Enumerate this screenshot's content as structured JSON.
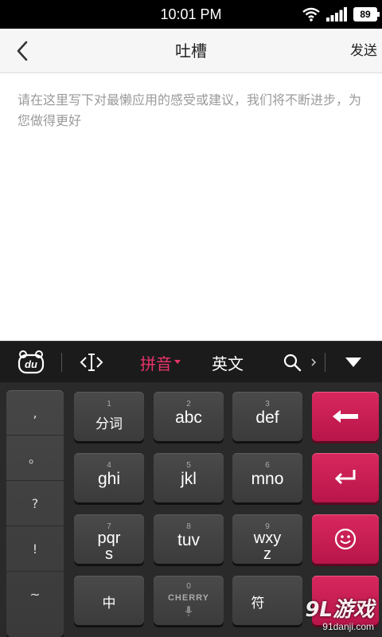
{
  "status_bar": {
    "time": "10:01 PM",
    "battery": "89",
    "icons": [
      "wifi-icon",
      "signal-icon",
      "battery-icon"
    ]
  },
  "header": {
    "title": "吐槽",
    "send_label": "发送",
    "back_icon": "chevron-left-icon"
  },
  "feedback": {
    "placeholder": "请在这里写下对最懒应用的感受或建议，我们将不断进步，为您做得更好",
    "value": ""
  },
  "keyboard_toolbar": {
    "logo": "du",
    "cursor_icon": "text-cursor-icon",
    "pinyin_label": "拼音",
    "english_label": "英文",
    "search_icon": "search-icon",
    "collapse_icon": "triangle-down-icon",
    "accent_color": "#e8336a"
  },
  "keyboard": {
    "punctuation": [
      ",",
      "。",
      "?",
      "!",
      "~"
    ],
    "keys": [
      {
        "num": "1",
        "label": "分词"
      },
      {
        "num": "2",
        "label": "abc"
      },
      {
        "num": "3",
        "label": "def"
      },
      {
        "num": "4",
        "label": "ghi"
      },
      {
        "num": "5",
        "label": "jkl"
      },
      {
        "num": "6",
        "label": "mno"
      },
      {
        "num": "7",
        "label": "pqr s"
      },
      {
        "num": "8",
        "label": "tuv"
      },
      {
        "num": "9",
        "label": "wxy z"
      },
      {
        "num": "",
        "label": "中"
      },
      {
        "num": "0",
        "label": "CHERRY"
      },
      {
        "num": "",
        "label": "符"
      }
    ],
    "side_keys": [
      "backspace-icon",
      "enter-icon",
      "smiley-icon",
      ""
    ],
    "key_color": "#3f3f3f",
    "side_key_color": "#c91c52"
  },
  "watermark": {
    "logo": "9L游戏",
    "url": "91danji.com"
  }
}
